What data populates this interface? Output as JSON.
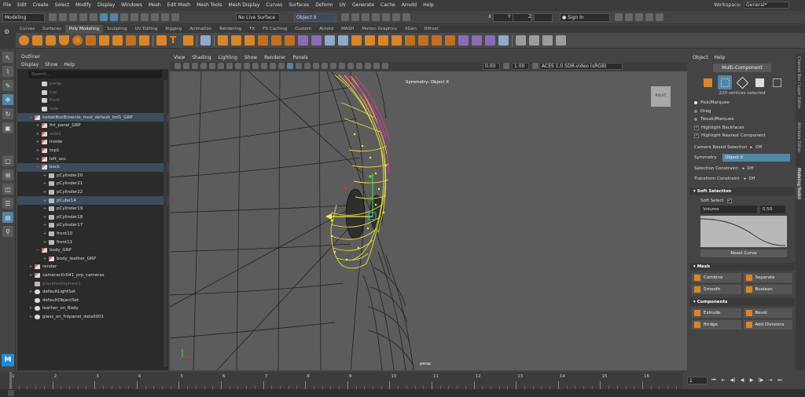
{
  "menubar": {
    "items": [
      "File",
      "Edit",
      "Create",
      "Select",
      "Modify",
      "Display",
      "Windows",
      "Mesh",
      "Edit Mesh",
      "Mesh Tools",
      "Mesh Display",
      "Curves",
      "Surfaces",
      "Deform",
      "UV",
      "Generate",
      "Cache",
      "Arnold",
      "Help"
    ],
    "workspace_label": "Workspace:",
    "workspace_value": "General*"
  },
  "statusline": {
    "mode": "Modeling",
    "live_surface": "No Live Surface",
    "symmetry": "Object X",
    "x_label": "X",
    "y_label": "Y",
    "z_label": "Z",
    "sign_in": "Sign In"
  },
  "shelf": {
    "tabs": [
      "Curves",
      "Surfaces",
      "Poly Modeling",
      "Sculpting",
      "UV Editing",
      "Rigging",
      "Animation",
      "Rendering",
      "FX",
      "FX Caching",
      "Custom",
      "Arnold",
      "MASH",
      "Motion Graphics",
      "XGen",
      "Bifrost"
    ],
    "active_tab": "Poly Modeling"
  },
  "outliner": {
    "title": "Outliner",
    "menu": [
      "Display",
      "Show",
      "Help"
    ],
    "search_placeholder": "Search...",
    "items": [
      {
        "label": "persp",
        "indent": 1,
        "kind": "camera",
        "dim": true,
        "exp": ""
      },
      {
        "label": "top",
        "indent": 1,
        "kind": "camera",
        "dim": true,
        "exp": ""
      },
      {
        "label": "front",
        "indent": 1,
        "kind": "camera",
        "dim": true,
        "exp": ""
      },
      {
        "label": "side",
        "indent": 1,
        "kind": "camera",
        "dim": true,
        "exp": ""
      },
      {
        "label": "kodakBoxBrownie_mod_default_lod1_GRP",
        "indent": 0,
        "kind": "group",
        "sel": true,
        "exp": "−"
      },
      {
        "label": "fnt_panel_GRP",
        "indent": 1,
        "kind": "group",
        "exp": "+"
      },
      {
        "label": "side1",
        "indent": 1,
        "kind": "group",
        "dim": true,
        "exp": "+"
      },
      {
        "label": "inside",
        "indent": 1,
        "kind": "group",
        "exp": "+"
      },
      {
        "label": "top1",
        "indent": 1,
        "kind": "group",
        "exp": "+"
      },
      {
        "label": "left_acc",
        "indent": 1,
        "kind": "group",
        "exp": "+"
      },
      {
        "label": "back",
        "indent": 1,
        "kind": "group",
        "sel": true,
        "exp": "−"
      },
      {
        "label": "pCylinder20",
        "indent": 2,
        "kind": "mesh",
        "exp": "+"
      },
      {
        "label": "pCylinder21",
        "indent": 2,
        "kind": "mesh",
        "exp": "+"
      },
      {
        "label": "pCylinder22",
        "indent": 2,
        "kind": "mesh",
        "exp": "+"
      },
      {
        "label": "pCube14",
        "indent": 2,
        "kind": "mesh",
        "sel": true,
        "exp": "+"
      },
      {
        "label": "pCylinder19",
        "indent": 2,
        "kind": "mesh",
        "exp": "+"
      },
      {
        "label": "pCylinder18",
        "indent": 2,
        "kind": "mesh",
        "exp": "+"
      },
      {
        "label": "pCylinder17",
        "indent": 2,
        "kind": "mesh",
        "exp": "+"
      },
      {
        "label": "front10",
        "indent": 2,
        "kind": "mesh",
        "exp": "+"
      },
      {
        "label": "front11",
        "indent": 2,
        "kind": "mesh",
        "exp": "+"
      },
      {
        "label": "body_GRP",
        "indent": 1,
        "kind": "group",
        "exp": "−"
      },
      {
        "label": "body_leather_GRP",
        "indent": 2,
        "kind": "group",
        "exp": "+"
      },
      {
        "label": "render",
        "indent": 0,
        "kind": "group",
        "exp": "+"
      },
      {
        "label": "cameractlr041_prp_cameras",
        "indent": 0,
        "kind": "group",
        "exp": "+"
      },
      {
        "label": "placeholdsphere1",
        "indent": 0,
        "kind": "mesh",
        "dim": true,
        "exp": ""
      },
      {
        "label": "defaultLightSet",
        "indent": 0,
        "kind": "set",
        "exp": "+"
      },
      {
        "label": "defaultObjectSet",
        "indent": 0,
        "kind": "set",
        "exp": ""
      },
      {
        "label": "leather_on_Body",
        "indent": 0,
        "kind": "set",
        "exp": "+"
      },
      {
        "label": "glass_on_fntpanel_detail001",
        "indent": 0,
        "kind": "set",
        "exp": "+"
      }
    ]
  },
  "viewport": {
    "menu": [
      "View",
      "Shading",
      "Lighting",
      "Show",
      "Renderer",
      "Panels"
    ],
    "exposure": "0.00",
    "gamma": "1.00",
    "colorspace": "ACES 1.0 SDR-video (sRGB)",
    "symmetry_label": "Symmetry: Object X",
    "camera_cube": "RIGHT",
    "camera_name": "persp"
  },
  "attribute": {
    "header": [
      "Object",
      "Help"
    ],
    "component_mode": "Multi-Component",
    "vertices_selected": "220 vertices selected",
    "pick_options": [
      {
        "label": "Pick/Marquee",
        "on": true
      },
      {
        "label": "Drag",
        "on": false
      },
      {
        "label": "Tweak/Marquee",
        "on": false
      }
    ],
    "checks": [
      {
        "label": "Highlight Backfaces",
        "on": true
      },
      {
        "label": "Highlight Nearest Component",
        "on": true
      }
    ],
    "camera_based_selection": {
      "label": "Camera Based Selection",
      "value": "Off"
    },
    "symmetry": {
      "label": "Symmetry",
      "value": "Object X"
    },
    "selection_constraint": {
      "label": "Selection Constraint",
      "value": "Off"
    },
    "transform_constraint": {
      "label": "Transform Constraint",
      "value": "Off"
    },
    "soft_selection": {
      "header": "Soft Selection",
      "soft_select_label": "Soft Select",
      "falloff": "Volume",
      "radius": "0.50",
      "reset": "Reset Curve"
    },
    "mesh": {
      "header": "Mesh",
      "buttons": [
        "Combine",
        "Separate",
        "Smooth",
        "Boolean"
      ]
    },
    "components": {
      "header": "Components",
      "buttons": [
        "Extrude",
        "Bevel",
        "Bridge",
        "Add Divisions"
      ]
    },
    "side_tabs": [
      "Channel Box / Layer Editor",
      "Attribute Editor",
      "Modeling Toolkit"
    ]
  },
  "timeline": {
    "ticks": [
      "1",
      "2",
      "3",
      "4",
      "5",
      "6",
      "7",
      "8",
      "9",
      "10",
      "11",
      "12",
      "13",
      "14",
      "15",
      "16"
    ],
    "current_frame": "1"
  },
  "logo": "M"
}
